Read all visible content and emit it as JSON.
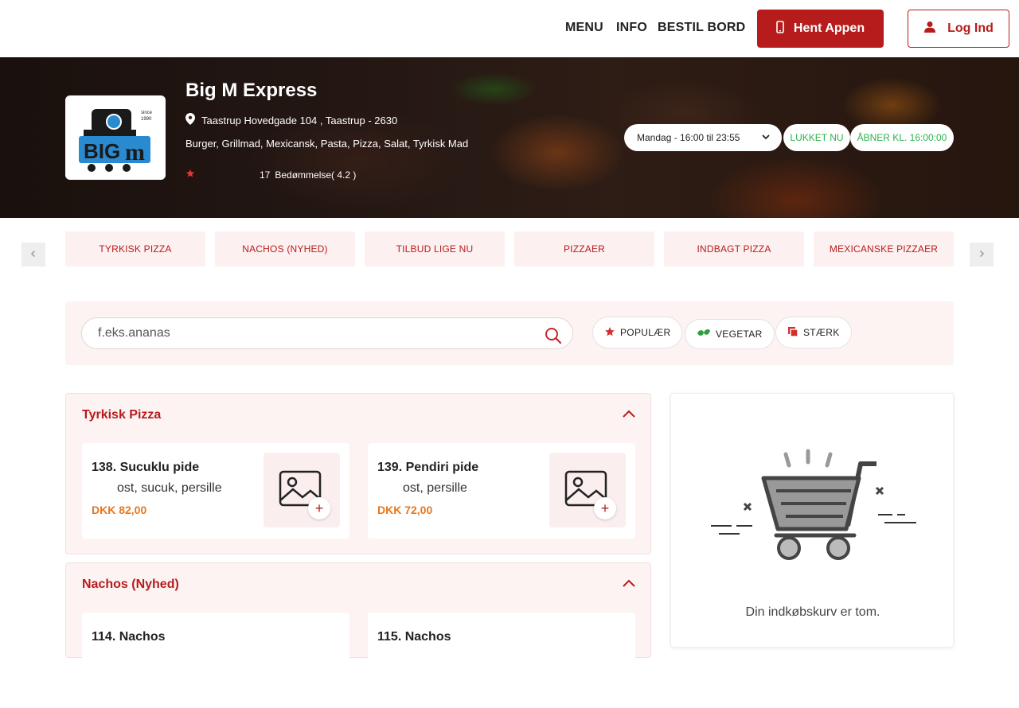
{
  "nav": {
    "menu": "MENU",
    "info": "INFO",
    "book": "BESTIL BORD",
    "get_app": "Hent Appen",
    "login": "Log Ind"
  },
  "restaurant": {
    "name": "Big M Express",
    "address": "Taastrup Hovedgade 104 , Taastrup - 2630",
    "cuisines": "Burger, Grillmad, Mexicansk, Pasta, Pizza, Salat, Tyrkisk Mad",
    "rating_count": "17",
    "rating_text": "Bedømmelse( 4.2 )",
    "rating_value": 4.2,
    "logo": {
      "main": "BIGm",
      "since": "since",
      "year": "1990"
    }
  },
  "hours": {
    "selected": "Mandag - 16:00 til 23:55",
    "status": "LUKKET NU",
    "opens": "ÅBNER KL. 16:00:00"
  },
  "categories": [
    "TYRKISK PIZZA",
    "NACHOS (NYHED)",
    "TILBUD LIGE NU",
    "PIZZAER",
    "INDBAGT PIZZA",
    "MEXICANSKE PIZZAER"
  ],
  "search": {
    "placeholder": "f.eks.ananas"
  },
  "filters": {
    "popular": "POPULÆR",
    "vegetarian": "VEGETAR",
    "strong": "STÆRK"
  },
  "sections": [
    {
      "title": "Tyrkisk Pizza",
      "items": [
        {
          "name": "138. Sucuklu pide",
          "desc": "ost, sucuk, persille",
          "price": "DKK 82,00"
        },
        {
          "name": "139. Pendiri pide",
          "desc": "ost, persille",
          "price": "DKK 72,00"
        }
      ]
    },
    {
      "title": "Nachos (Nyhed)",
      "items": [
        {
          "name": "114. Nachos"
        },
        {
          "name": "115. Nachos"
        }
      ]
    }
  ],
  "cart": {
    "empty_text": "Din indkøbskurv er tom."
  },
  "colors": {
    "brand": "#b71c1c",
    "price": "#e8771c",
    "open_status": "#2db34a"
  },
  "icons": {
    "phone": "phone-icon",
    "user": "user-icon",
    "location": "location-pin-icon",
    "star": "star-icon",
    "search": "search-icon",
    "leaf": "leaf-icon",
    "chili": "chili-icon",
    "image_placeholder": "image-placeholder-icon",
    "cart": "shopping-cart-icon"
  }
}
